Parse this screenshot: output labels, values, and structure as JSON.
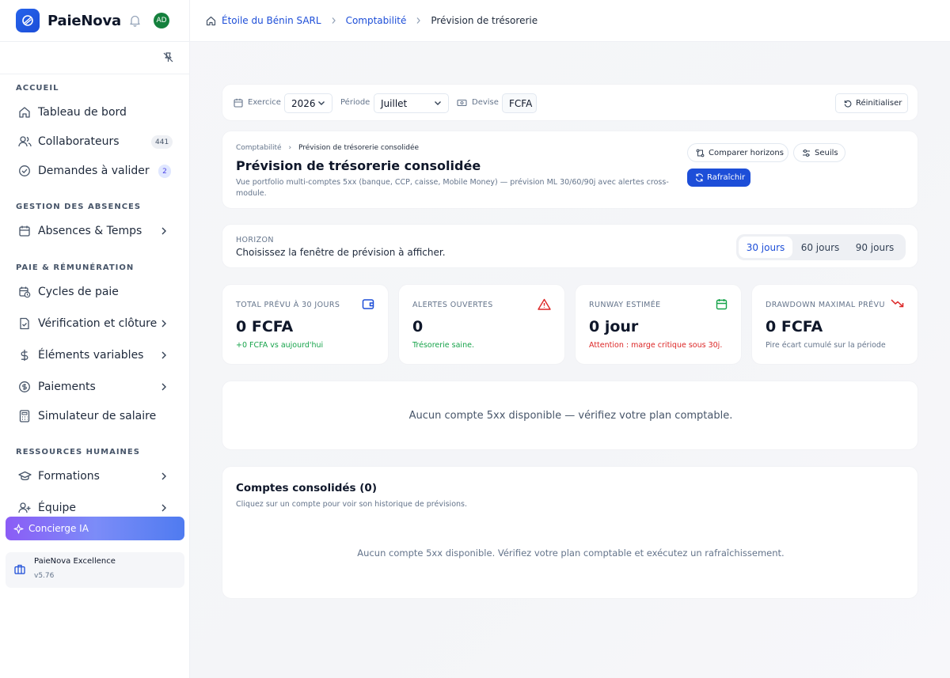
{
  "app": {
    "name": "PaieNova",
    "avatar_initials": "AD"
  },
  "breadcrumb": [
    "Étoile du Bénin SARL",
    "Comptabilité",
    "Prévision de trésorerie"
  ],
  "sidebar": {
    "sections": [
      {
        "label": "ACCUEIL"
      },
      {
        "label": "GESTION DES ABSENCES"
      },
      {
        "label": "PAIE & RÉMUNÉRATION"
      },
      {
        "label": "RESSOURCES HUMAINES"
      }
    ],
    "items": [
      {
        "label": "Tableau de bord",
        "icon": "home-icon"
      },
      {
        "label": "Collaborateurs",
        "icon": "users-icon",
        "badge": "441"
      },
      {
        "label": "Demandes à valider",
        "icon": "check-circle-icon",
        "badge": "2"
      },
      {
        "label": "Absences & Temps",
        "icon": "calendar-icon"
      },
      {
        "label": "Cycles de paie",
        "icon": "calendar-clock-icon"
      },
      {
        "label": "Vérification et clôture",
        "icon": "file-check-icon"
      },
      {
        "label": "Éléments variables",
        "icon": "dollar-icon"
      },
      {
        "label": "Paiements",
        "icon": "coin-icon"
      },
      {
        "label": "Simulateur de salaire",
        "icon": "calculator-icon"
      },
      {
        "label": "Formations",
        "icon": "graduation-cap-icon"
      },
      {
        "label": "Équipe",
        "icon": "user-plus-icon"
      }
    ],
    "concierge": "Concierge IA",
    "plan": {
      "title": "PaieNova Excellence",
      "version": "v5.76"
    }
  },
  "filters": {
    "exercice_label": "Exercice",
    "exercice_value": "2026",
    "periode_label": "Période",
    "periode_value": "Juillet",
    "devise_label": "Devise",
    "devise_value": "FCFA",
    "reset": "Réinitialiser"
  },
  "header": {
    "crumb_parent": "Comptabilité",
    "crumb_current": "Prévision de trésorerie consolidée",
    "title": "Prévision de trésorerie consolidée",
    "description": "Vue portfolio multi-comptes 5xx (banque, CCP, caisse, Mobile Money) — prévision ML 30/60/90j avec alertes cross-module.",
    "compare_button": "Comparer horizons",
    "thresholds_button": "Seuils",
    "refresh_button": "Rafraîchir"
  },
  "horizon": {
    "label": "HORIZON",
    "description": "Choisissez la fenêtre de prévision à afficher.",
    "options": [
      "30 jours",
      "60 jours",
      "90 jours"
    ],
    "selected": "30 jours"
  },
  "kpis": [
    {
      "label": "TOTAL PRÉVU À 30 JOURS",
      "value": "0 FCFA",
      "note": "+0 FCFA vs aujourd'hui",
      "note_color": "#16a34a",
      "icon": "wallet-icon",
      "icon_color": "#1d4ed8"
    },
    {
      "label": "ALERTES OUVERTES",
      "value": "0",
      "note": "Trésorerie saine.",
      "note_color": "#16a34a",
      "icon": "warning-icon",
      "icon_color": "#dc2626"
    },
    {
      "label": "RUNWAY ESTIMÉE",
      "value": "0 jour",
      "note": "Attention : marge critique sous 30j.",
      "note_color": "#dc2626",
      "icon": "calendar-icon",
      "icon_color": "#16a34a"
    },
    {
      "label": "DRAWDOWN MAXIMAL PRÉVU",
      "value": "0 FCFA",
      "note": "Pire écart cumulé sur la période",
      "note_color": "#64748b",
      "icon": "trending-down-icon",
      "icon_color": "#dc2626"
    }
  ],
  "empty_state": "Aucun compte 5xx disponible — vérifiez votre plan comptable.",
  "accounts": {
    "title": "Comptes consolidés (0)",
    "subtitle": "Cliquez sur un compte pour voir son historique de prévisions.",
    "empty": "Aucun compte 5xx disponible. Vérifiez votre plan comptable et exécutez un rafraîchissement."
  },
  "colors": {
    "accent": "#1d4ed8",
    "success": "#16a34a",
    "danger": "#dc2626",
    "avatar": "#15803d"
  }
}
